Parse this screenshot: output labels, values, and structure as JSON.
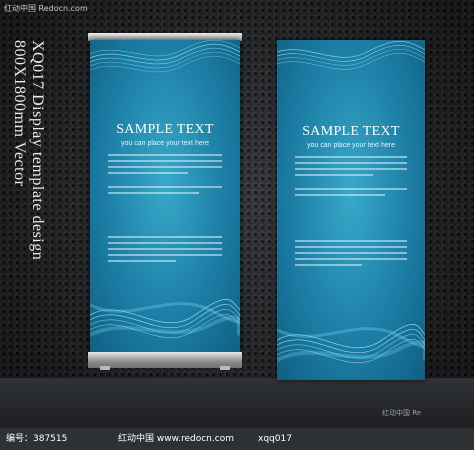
{
  "watermark_top": "红动中国 Redocn.com",
  "title_lines": [
    "XQ017 Display template design",
    "800X1800mm Vector"
  ],
  "banners": [
    {
      "sample_title": "SAMPLE TEXT",
      "sample_sub": "you can place your text here"
    },
    {
      "sample_title": "SAMPLE TEXT",
      "sample_sub": "you can place your text here"
    }
  ],
  "corner_logo": "红动中国 Re",
  "footer": {
    "id_label": "编号：387515",
    "site": "红动中国 www.redocn.com",
    "code": "xqq017"
  },
  "colors": {
    "banner_light": "#38a9c9",
    "banner_dark": "#0f5f83",
    "wave": "#8fe6ff"
  }
}
